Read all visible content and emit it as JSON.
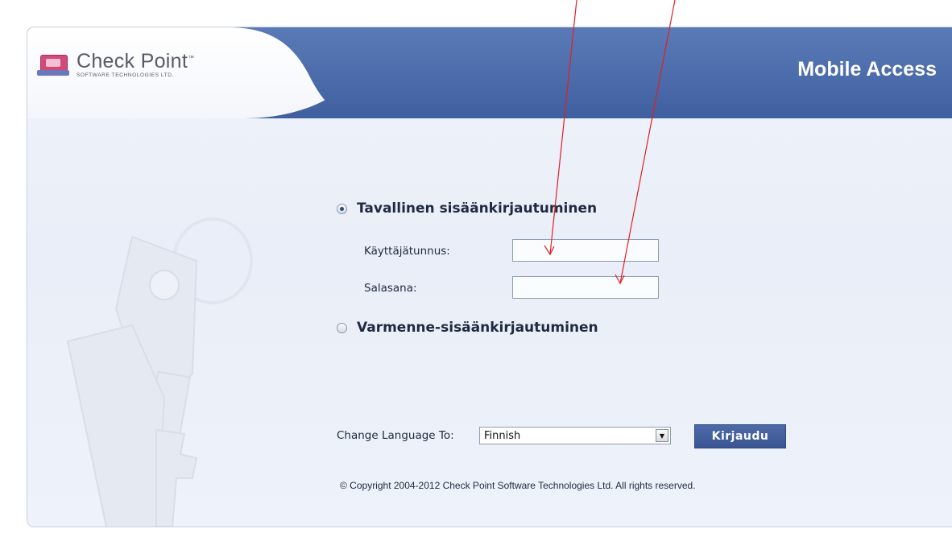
{
  "brand": {
    "name": "Check Point",
    "trademark": "™",
    "tagline": "SOFTWARE TECHNOLOGIES LTD."
  },
  "product_title": "Mobile Access",
  "login": {
    "standard_option_label": "Tavallinen sisäänkirjautuminen",
    "standard_selected": true,
    "username_label": "Käyttäjätunnus:",
    "username_value": "",
    "password_label": "Salasana:",
    "password_value": "",
    "certificate_option_label": "Varmenne-sisäänkirjautuminen",
    "certificate_selected": false
  },
  "language": {
    "label": "Change Language To:",
    "selected": "Finnish"
  },
  "submit_label": "Kirjaudu",
  "copyright": "© Copyright 2004-2012   Check Point Software Technologies Ltd. All rights reserved.",
  "colors": {
    "header_blue": "#4a6aa9",
    "button_blue": "#3f5b97",
    "annotation_red": "#e02020",
    "background": "#eaeff8"
  }
}
